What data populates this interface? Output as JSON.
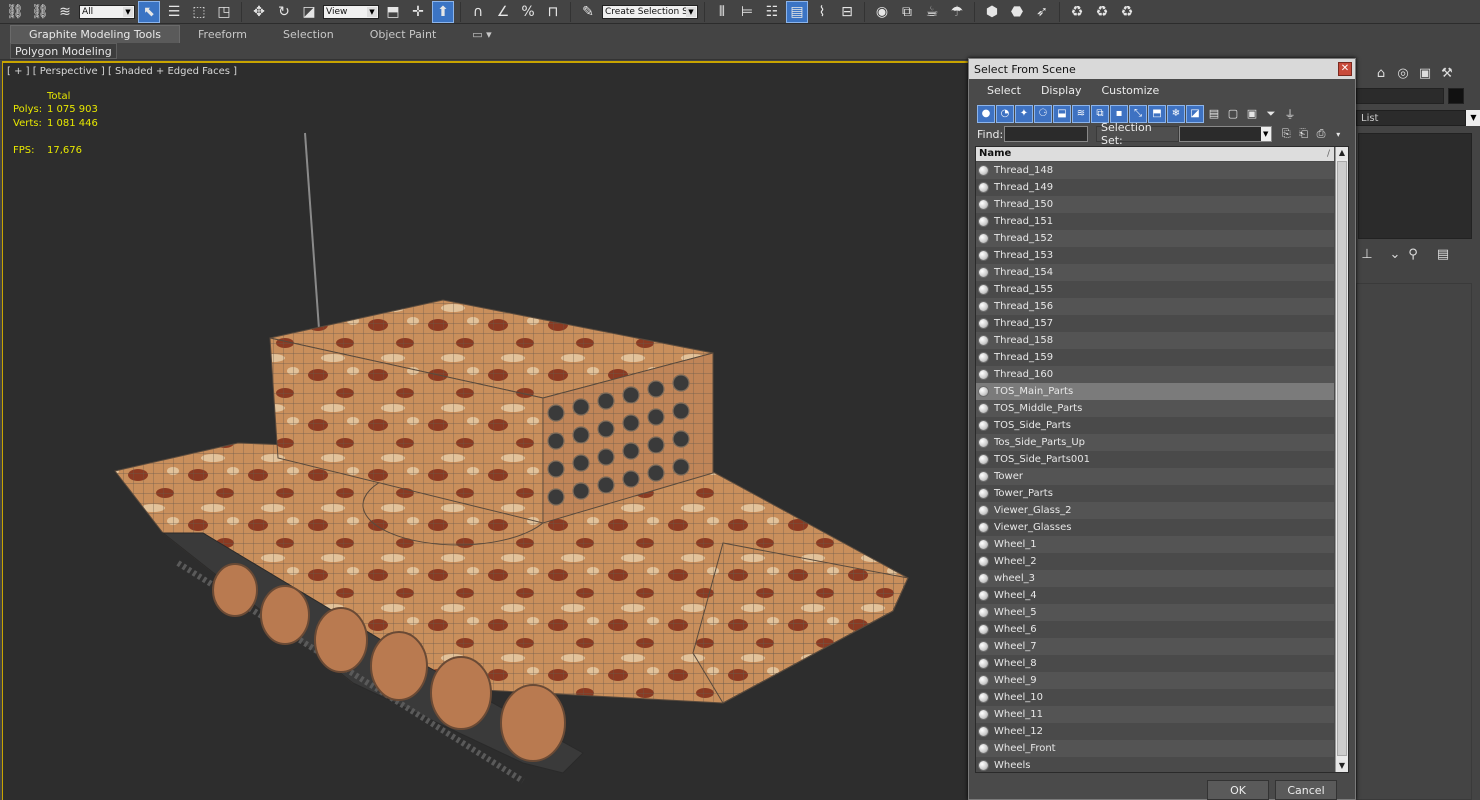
{
  "toolbar": {
    "selection_filter": "All",
    "reference_coord": "View",
    "named_selection_placeholder": "Create Selection Se"
  },
  "ribbon": {
    "tabs": [
      "Graphite Modeling Tools",
      "Freeform",
      "Selection",
      "Object Paint"
    ],
    "panel_label": "Polygon Modeling"
  },
  "viewport": {
    "label": "[ + ] [ Perspective ] [ Shaded + Edged Faces ]",
    "stats": {
      "total_label": "Total",
      "polys_label": "Polys:",
      "polys_value": "1 075 903",
      "verts_label": "Verts:",
      "verts_value": "1 081 446",
      "fps_label": "FPS:",
      "fps_value": "17,676"
    }
  },
  "command_panel": {
    "modifier_list_label": "List"
  },
  "dialog": {
    "title": "Select From Scene",
    "close_symbol": "✕",
    "menu": [
      "Select",
      "Display",
      "Customize"
    ],
    "find_label": "Find:",
    "find_value": "",
    "selection_set_label": "Selection Set:",
    "column_header": "Name",
    "sort_indicator": "/",
    "ok_label": "OK",
    "cancel_label": "Cancel",
    "selected_item": "TOS_Main_Parts",
    "items": [
      "Thread_148",
      "Thread_149",
      "Thread_150",
      "Thread_151",
      "Thread_152",
      "Thread_153",
      "Thread_154",
      "Thread_155",
      "Thread_156",
      "Thread_157",
      "Thread_158",
      "Thread_159",
      "Thread_160",
      "TOS_Main_Parts",
      "TOS_Middle_Parts",
      "TOS_Side_Parts",
      "Tos_Side_Parts_Up",
      "TOS_Side_Parts001",
      "Tower",
      "Tower_Parts",
      "Viewer_Glass_2",
      "Viewer_Glasses",
      "Wheel_1",
      "Wheel_2",
      "wheel_3",
      "Wheel_4",
      "Wheel_5",
      "Wheel_6",
      "Wheel_7",
      "Wheel_8",
      "Wheel_9",
      "Wheel_10",
      "Wheel_11",
      "Wheel_12",
      "Wheel_Front",
      "Wheels"
    ]
  },
  "colors": {
    "viewport_bg": "#2d2d2d",
    "active_border": "#c8a400",
    "stats_text": "#e8e800",
    "filter_active": "#3e72c2",
    "selected_row": "#7b7b7b"
  }
}
